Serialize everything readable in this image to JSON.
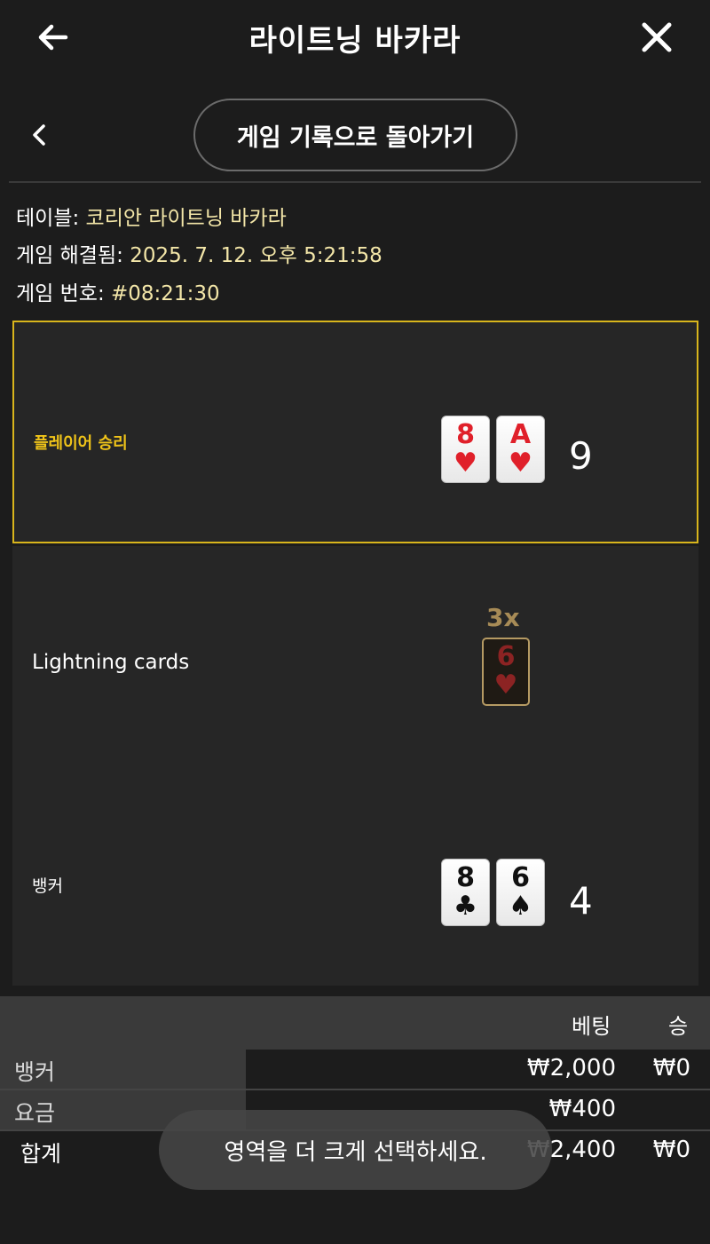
{
  "header": {
    "title": "라이트닝 바카라"
  },
  "subnav": {
    "back_to_history": "게임 기록으로 돌아가기"
  },
  "info": {
    "table_label": "테이블:",
    "table_value": "코리안 라이트닝 바카라",
    "resolved_label": "게임 해결됨:",
    "resolved_value": "2025. 7. 12. 오후 5:21:58",
    "number_label": "게임 번호:",
    "number_value": "#08:21:30"
  },
  "player": {
    "label": "플레이어 승리",
    "cards": [
      {
        "rank": "8",
        "suit": "♥"
      },
      {
        "rank": "A",
        "suit": "♥"
      }
    ],
    "score": "9"
  },
  "lightning": {
    "label": "Lightning cards",
    "multiplier": "3x",
    "card": {
      "rank": "6",
      "suit": "♥"
    }
  },
  "banker": {
    "label": "뱅커",
    "cards": [
      {
        "rank": "8",
        "suit": "♣"
      },
      {
        "rank": "6",
        "suit": "♠"
      }
    ],
    "score": "4"
  },
  "bets": {
    "col_bet": "베팅",
    "col_win": "승",
    "rows": [
      {
        "label": "뱅커",
        "bet": "₩2,000",
        "win": "₩0"
      },
      {
        "label": "요금",
        "bet": "₩400",
        "win": ""
      },
      {
        "label": "합계",
        "bet": "₩2,400",
        "win": "₩0"
      }
    ]
  },
  "toast": "영역을 더 크게 선택하세요.",
  "colors": {
    "win_border": "#d8b51c",
    "win_label": "#f0c419",
    "info_value": "#f3e6a8",
    "heart": "#e0202a"
  }
}
